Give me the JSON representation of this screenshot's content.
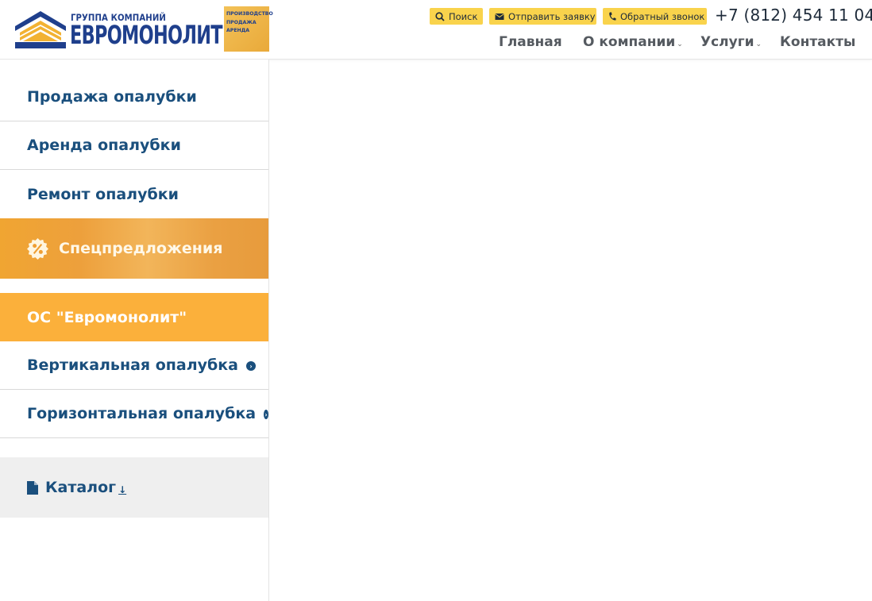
{
  "header": {
    "logo": {
      "subtitle": "ГРУППА КОМПАНИЙ",
      "name": "ЕВРОМОНОЛИТ",
      "badge_lines": [
        "ПРОИЗВОДСТВО",
        "ПРОДАЖА",
        "АРЕНДА"
      ]
    },
    "top_buttons": {
      "search": {
        "label": "Поиск",
        "icon": "search-icon"
      },
      "request": {
        "label": "Отправить заявку",
        "icon": "envelope-icon"
      },
      "callback": {
        "label": "Обратный звонок",
        "icon": "phone-icon"
      }
    },
    "phone": "+7 (812) 454 11 04",
    "nav": {
      "home": "Главная",
      "about": "О компании",
      "services": "Услуги",
      "contacts": "Контакты",
      "dropdown_glyph": "⌄"
    },
    "colors": {
      "button_bg": "#f9d34c",
      "brand_blue": "#1f3f8c"
    }
  },
  "sidebar": {
    "items": [
      {
        "label": "Продажа опалубки"
      },
      {
        "label": "Аренда опалубки"
      },
      {
        "label": "Ремонт опалубки"
      }
    ],
    "promo": {
      "label": "Спецпредложения",
      "icon": "percent-badge-icon"
    },
    "active": {
      "label": "ОС \"Евромонолит\""
    },
    "sub_items": [
      {
        "label": "Вертикальная опалубка",
        "icon": "chevron-right-circle-icon"
      },
      {
        "label": "Горизонтальная опалубка",
        "icon": "chevron-right-circle-icon"
      }
    ],
    "catalog": {
      "label": "Каталог",
      "arrow": "↓",
      "icon": "document-icon"
    },
    "colors": {
      "link": "#1a4f7d",
      "active_bg": "#fbb03b",
      "catalog_bg": "#efefef"
    }
  }
}
